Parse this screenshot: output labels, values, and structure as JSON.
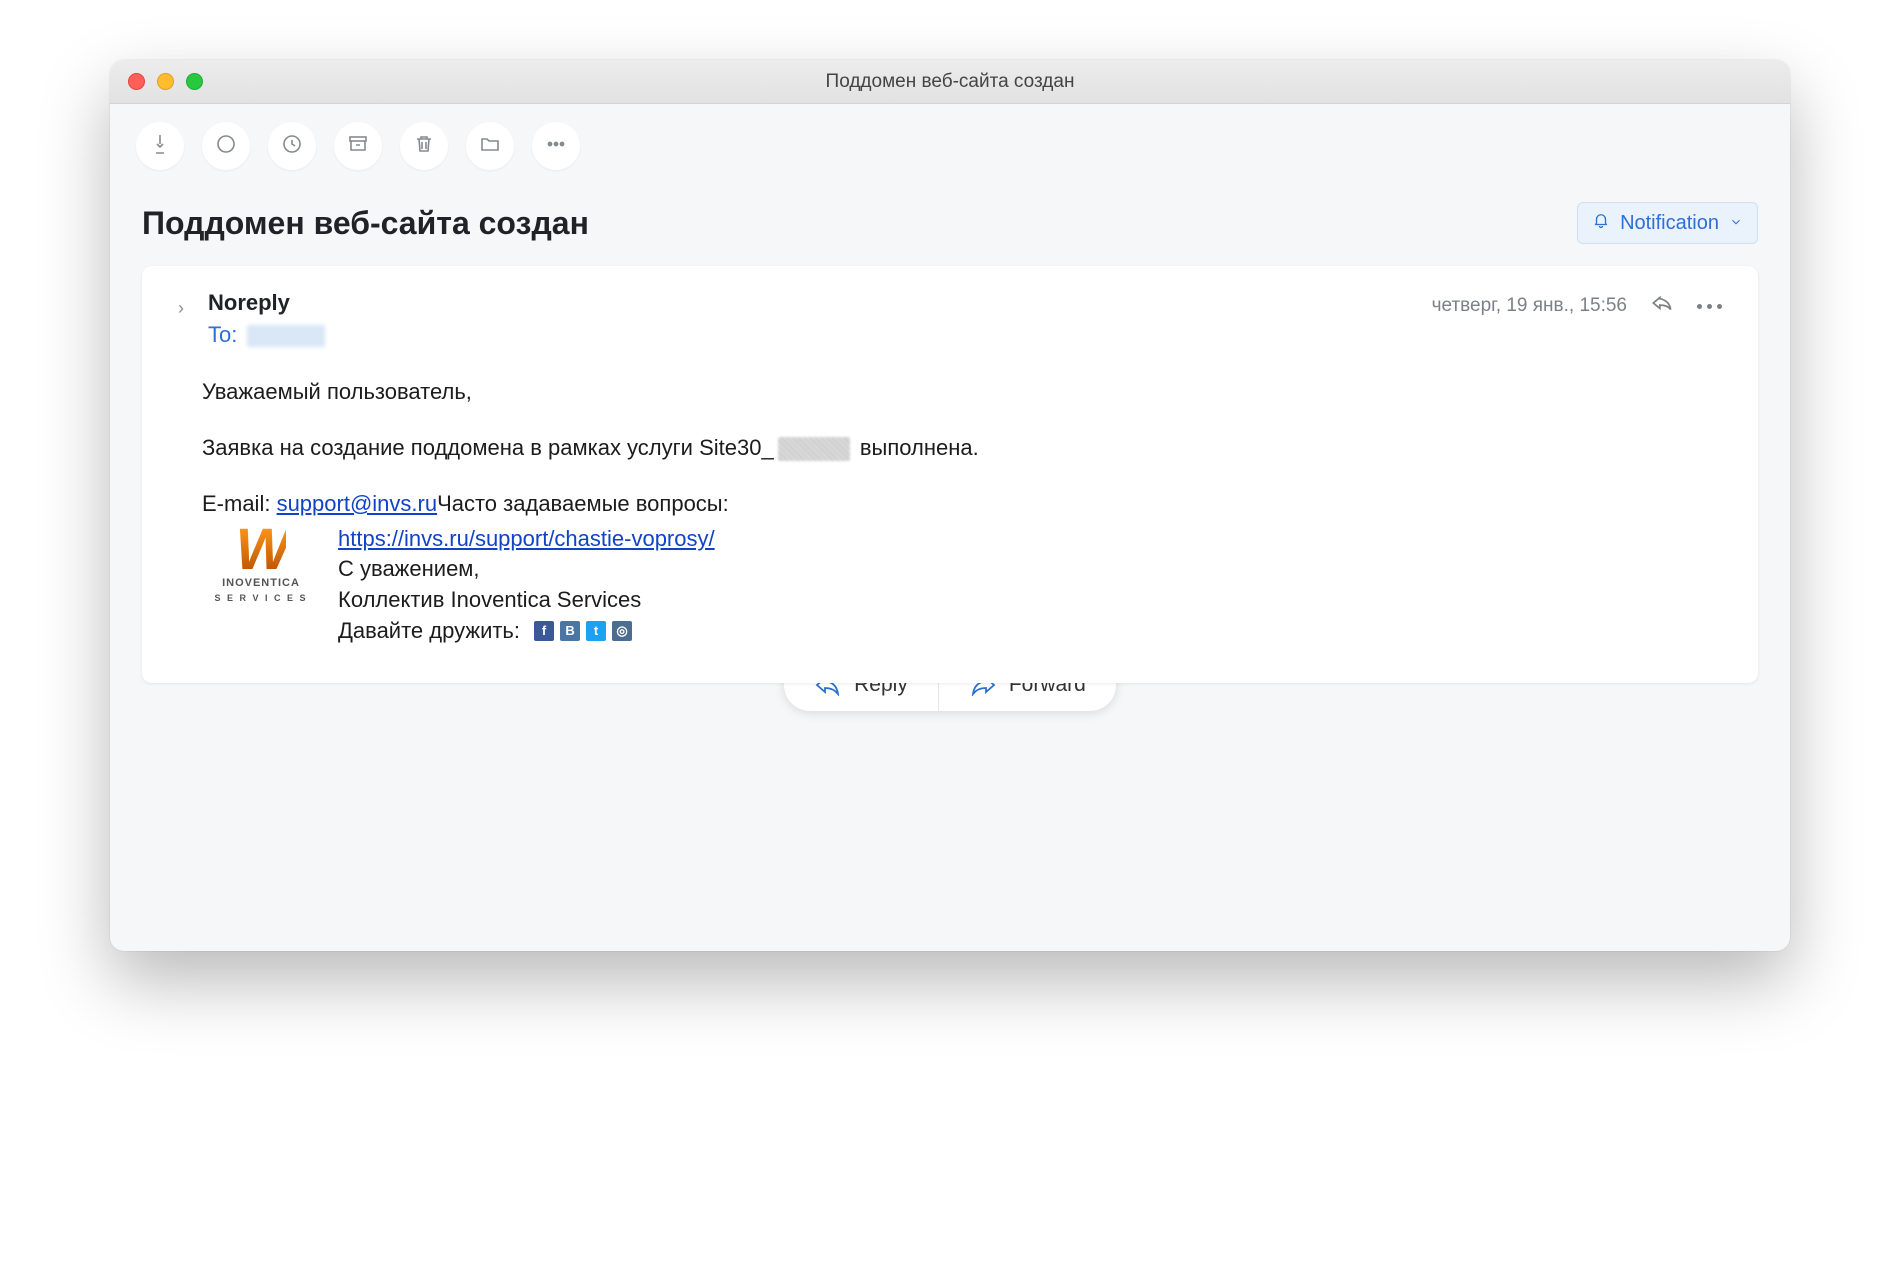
{
  "window": {
    "title": "Поддомен веб-сайта создан"
  },
  "subject": "Поддомен веб-сайта создан",
  "notification": {
    "label": "Notification"
  },
  "message": {
    "from": "Noreply",
    "to_label": "To:",
    "date": "четверг, 19 янв., 15:56",
    "greeting": "Уважаемый пользователь,",
    "line_pre": "Заявка на создание поддомена в рамках услуги Site30_",
    "line_post": " выполнена.",
    "email_label": "E-mail: ",
    "email_link": "support@invs.ru",
    "faq_label": "Часто задаваемые вопросы:",
    "faq_link": "https://invs.ru/support/chastie-voprosy/",
    "sig1": "С уважением,",
    "sig2": "Коллектив Inoventica Services",
    "sig3": "Давайте дружить:",
    "logo_top": "INOVENTICA",
    "logo_sub": "S E R V I C E S"
  },
  "actions": {
    "reply": "Reply",
    "forward": "Forward"
  },
  "social": {
    "fb": "f",
    "vk": "B",
    "tw": "t",
    "ig": "◎"
  }
}
